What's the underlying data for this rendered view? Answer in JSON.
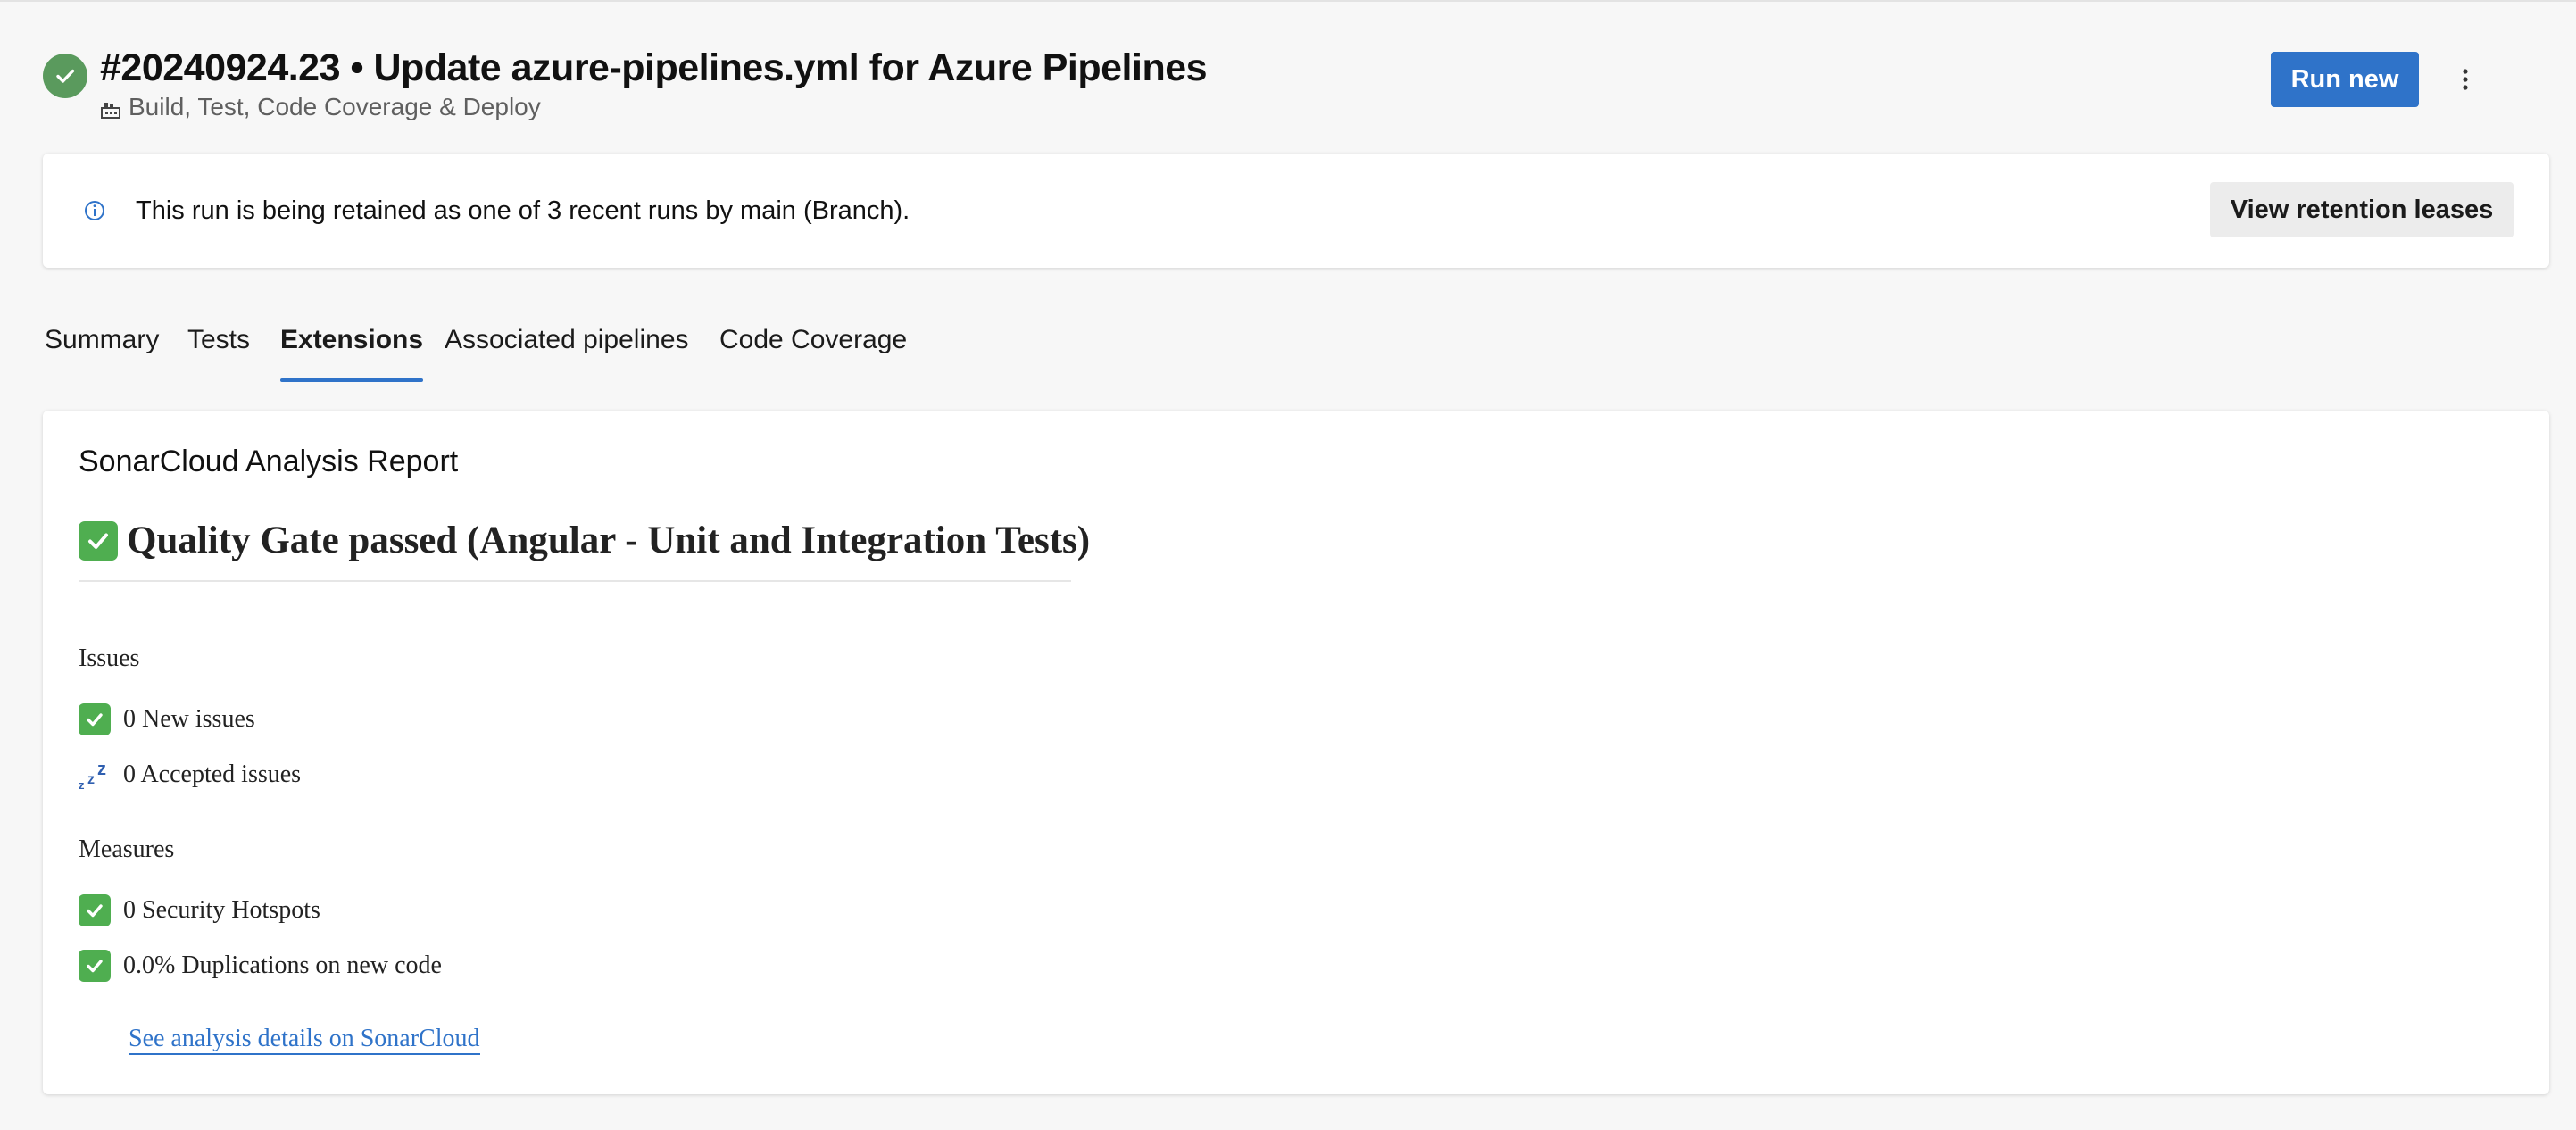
{
  "header": {
    "title": "#20240924.23 • Update azure-pipelines.yml for Azure Pipelines",
    "pipeline_name": "Build, Test, Code Coverage & Deploy",
    "run_new_label": "Run new",
    "more_actions_icon": "vertical-ellipsis"
  },
  "banner": {
    "message": "This run is being retained as one of 3 recent runs by main (Branch).",
    "action_label": "View retention leases",
    "icon": "info-icon"
  },
  "tabs": [
    {
      "label": "Summary",
      "active": false
    },
    {
      "label": "Tests",
      "active": false
    },
    {
      "label": "Extensions",
      "active": true
    },
    {
      "label": "Associated pipelines",
      "active": false
    },
    {
      "label": "Code Coverage",
      "active": false
    }
  ],
  "report": {
    "title": "SonarCloud Analysis Report",
    "gate_heading": "Quality Gate passed (Angular - Unit and Integration Tests)",
    "issues_label": "Issues",
    "issues": [
      {
        "text": "0 New issues",
        "icon": "check-icon"
      },
      {
        "text": "0 Accepted issues",
        "icon": "zzz-icon"
      }
    ],
    "measures_label": "Measures",
    "measures": [
      {
        "text": "0 Security Hotspots",
        "icon": "check-icon"
      },
      {
        "text": "0.0% Duplications on new code",
        "icon": "check-icon"
      }
    ],
    "link_text": "See analysis details on SonarCloud"
  },
  "colors": {
    "accent": "#2f73c9",
    "success": "#5a9a5d",
    "check_green": "#4fae50"
  }
}
